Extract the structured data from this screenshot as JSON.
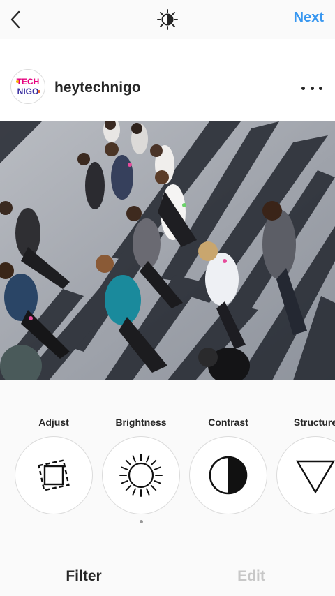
{
  "topbar": {
    "back_icon": "chevron-left-icon",
    "center_icon": "lux-sun-icon",
    "next_label": "Next",
    "accent_color": "#3897f0"
  },
  "profile": {
    "username": "heytechnigo",
    "avatar_text_line1": "TECH",
    "avatar_text_line2": "NIGO",
    "more_icon": "more-options-icon"
  },
  "photo": {
    "description_icon": "photo-preview"
  },
  "tools": [
    {
      "label": "Adjust",
      "icon": "adjust-icon"
    },
    {
      "label": "Brightness",
      "icon": "brightness-icon"
    },
    {
      "label": "Contrast",
      "icon": "contrast-icon"
    },
    {
      "label": "Structure",
      "icon": "structure-icon"
    }
  ],
  "tabs": {
    "filter_label": "Filter",
    "edit_label": "Edit",
    "active": "Filter"
  }
}
